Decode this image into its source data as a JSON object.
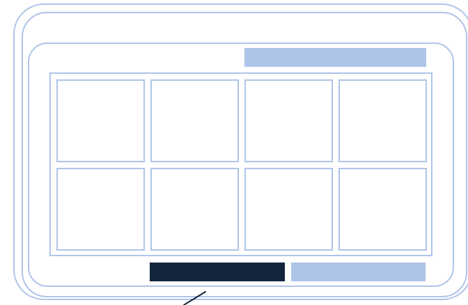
{
  "app": {
    "title": ""
  },
  "header": {
    "bar_label": ""
  },
  "grid": {
    "rows": 2,
    "columns": 4,
    "cells": [
      {
        "label": ""
      },
      {
        "label": ""
      },
      {
        "label": ""
      },
      {
        "label": ""
      },
      {
        "label": ""
      },
      {
        "label": ""
      },
      {
        "label": ""
      },
      {
        "label": ""
      }
    ]
  },
  "footer": {
    "primary_label": "",
    "secondary_label": ""
  },
  "colors": {
    "outline": "#aec4e8",
    "primary": "#13253d",
    "secondary": "#aec4e8",
    "background": "#ffffff"
  },
  "icons": {
    "pointer": "pointer-line-icon"
  }
}
